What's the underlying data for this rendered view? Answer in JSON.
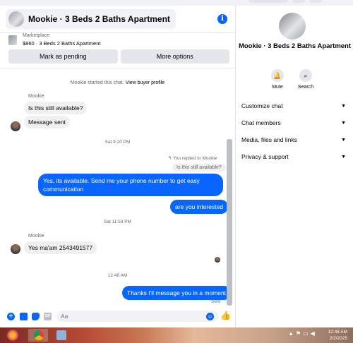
{
  "header": {
    "title": "Mookie · 3 Beds 2 Baths Apartment",
    "info_icon": "i"
  },
  "listing": {
    "category": "Marketplace",
    "summary": "$860 · 3 Beds 2 Baths Apartment"
  },
  "actions": {
    "mark_pending": "Mark as pending",
    "more_options": "More options"
  },
  "conversation": {
    "started_text": "Mookie started this chat.",
    "buyer_profile_link": "View buyer profile",
    "sender1": "Mookie",
    "msg1": "Is this still available?",
    "msg2": "Message sent",
    "time1": "Sat 9:20 PM",
    "replied_label": "You replied to Mookie",
    "replied_quote": "Is this still available?",
    "reply1": "Yes, its available. Send me your phone number to get easy communication",
    "reply2": "are you interested",
    "time2": "Sat 11:53 PM",
    "sender2": "Mookie",
    "msg3": "Yes ma'am 2543491577",
    "time3": "12:48 AM",
    "reply3": "Thanks I'll message you in a moment",
    "status": "Sent"
  },
  "composer": {
    "placeholder": "Aa"
  },
  "sidebar": {
    "name": "Mookie · 3 Beds 2 Baths Apartment",
    "mute_label": "Mute",
    "search_label": "Search",
    "items": [
      {
        "label": "Customize chat"
      },
      {
        "label": "Chat members"
      },
      {
        "label": "Media, files and links"
      },
      {
        "label": "Privacy & support"
      }
    ]
  },
  "taskbar": {
    "time": "12:48 AM",
    "date": "2/2/2025"
  },
  "colors": {
    "accent": "#0866ff",
    "bubble_in": "#f0f0f0"
  }
}
